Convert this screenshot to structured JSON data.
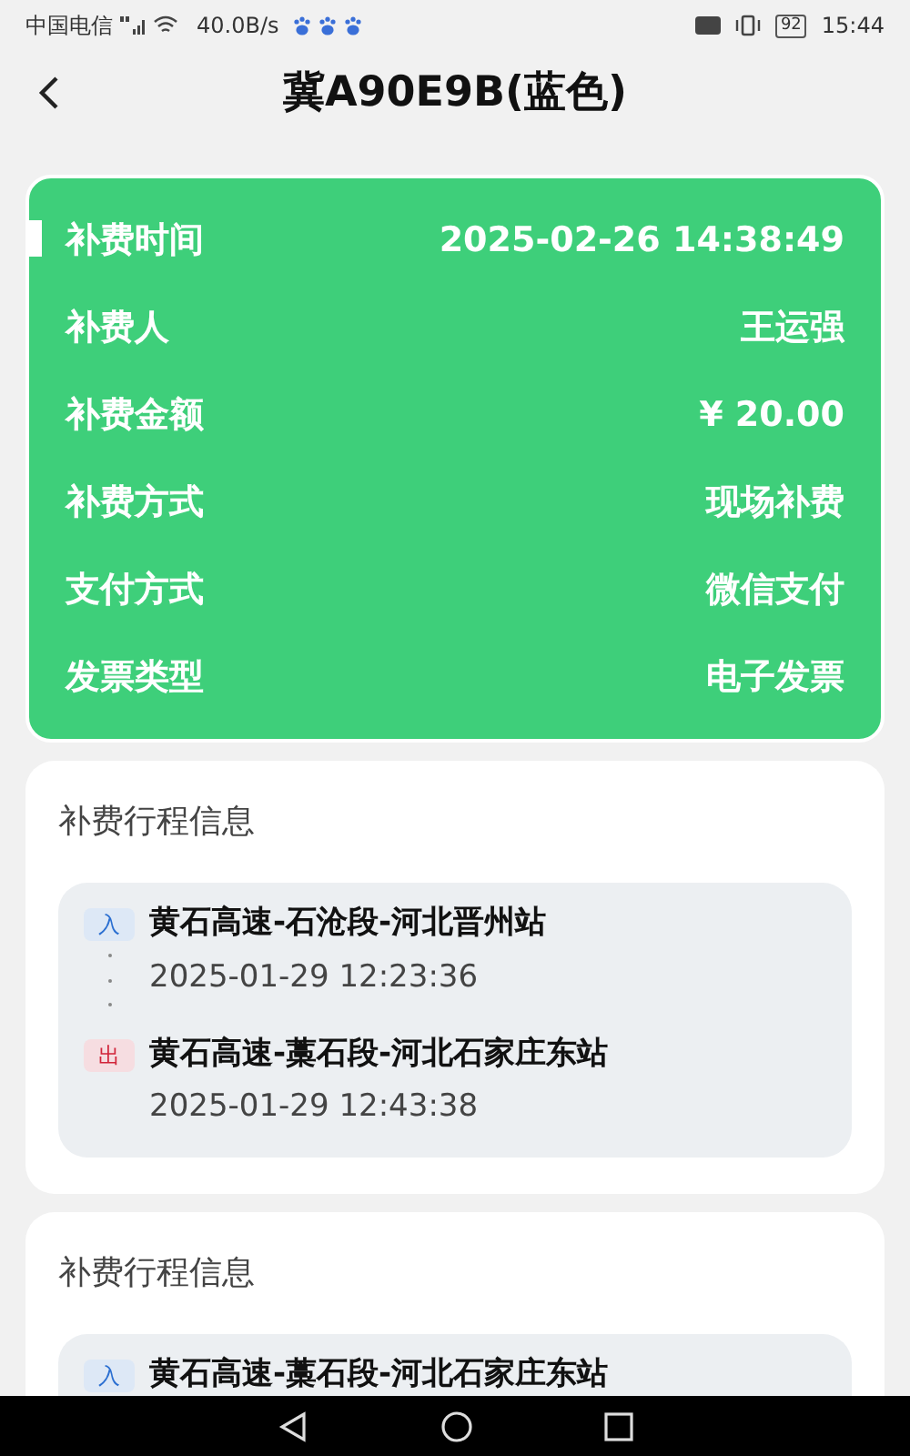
{
  "status_bar": {
    "carrier": "中国电信",
    "network_speed": "40.0B/s",
    "battery": "92",
    "time": "15:44"
  },
  "header": {
    "title": "冀A90E9B(蓝色)"
  },
  "summary": {
    "rows": [
      {
        "label": "补费时间",
        "value": "2025-02-26 14:38:49",
        "marked": true
      },
      {
        "label": "补费人",
        "value": "王运强",
        "marked": false
      },
      {
        "label": "补费金额",
        "value": "¥ 20.00",
        "marked": false
      },
      {
        "label": "补费方式",
        "value": "现场补费",
        "marked": false
      },
      {
        "label": "支付方式",
        "value": "微信支付",
        "marked": false
      },
      {
        "label": "发票类型",
        "value": "电子发票",
        "marked": false
      }
    ]
  },
  "trips": [
    {
      "title": "补费行程信息",
      "legs": [
        {
          "kind": "entry",
          "tag": "入",
          "station": "黄石高速-石沧段-河北晋州站",
          "time": "2025-01-29 12:23:36"
        },
        {
          "kind": "exit",
          "tag": "出",
          "station": "黄石高速-藁石段-河北石家庄东站",
          "time": "2025-01-29 12:43:38"
        }
      ]
    },
    {
      "title": "补费行程信息",
      "legs": [
        {
          "kind": "entry",
          "tag": "入",
          "station": "黄石高速-藁石段-河北石家庄东站"
        }
      ]
    }
  ]
}
